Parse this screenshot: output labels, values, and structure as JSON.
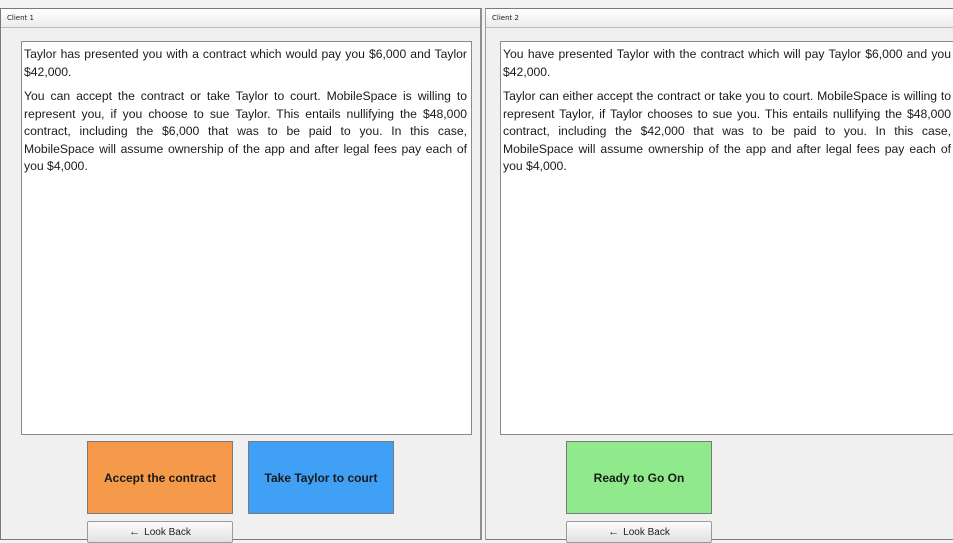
{
  "client1": {
    "title": "Client 1",
    "paragraphs": [
      "Taylor has presented you with a contract which would pay you $6,000 and Taylor $42,000.",
      "You can accept the contract or take Taylor to court. MobileSpace is willing to represent you, if you choose to sue Taylor.  This entails nullifying the $48,000 contract, including the $6,000 that was to be paid to you. In this case, MobileSpace will assume ownership of the app and after legal fees pay each of you $4,000."
    ],
    "accept_label": "Accept the contract",
    "court_label": "Take Taylor to court",
    "look_back_label": "Look Back"
  },
  "client2": {
    "title": "Client 2",
    "paragraphs": [
      "You have presented Taylor with the contract which will pay Taylor $6,000 and you $42,000.",
      "Taylor can either accept the contract or take you to court. MobileSpace is willing to represent Taylor, if Taylor chooses to sue you. This entails nullifying the $48,000 contract, including the $42,000 that was to be paid to you. In this case, MobileSpace will assume ownership of the app and after legal fees pay each of you $4,000."
    ],
    "ready_label": "Ready to Go On",
    "look_back_label": "Look Back"
  },
  "colors": {
    "accept_button": "#f5994a",
    "court_button": "#3fa0f5",
    "ready_button": "#90ea8c"
  },
  "icons": {
    "look_back": "left-arrow-icon"
  }
}
